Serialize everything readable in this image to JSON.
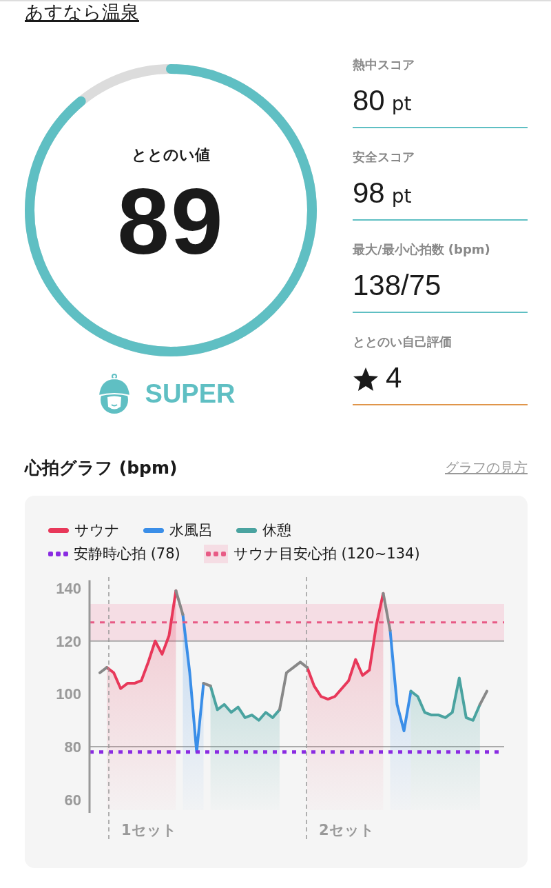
{
  "title": "あすなら温泉",
  "gauge": {
    "label": "ととのい値",
    "value": "89",
    "level": 0.89
  },
  "rank": {
    "label": "SUPER"
  },
  "stats": [
    {
      "kind": "score",
      "label": "熱中スコア",
      "value": "80",
      "unit": "pt",
      "color": "#5fbfc3"
    },
    {
      "kind": "score",
      "label": "安全スコア",
      "value": "98",
      "unit": "pt",
      "color": "#5fbfc3"
    },
    {
      "kind": "plain",
      "label": "最大/最小心拍数 (bpm)",
      "value": "138/75",
      "color": "#5fbfc3"
    },
    {
      "kind": "rating",
      "label": "ととのい自己評価",
      "value": "4",
      "color": "#e0954a"
    }
  ],
  "heart_graph": {
    "title": "心拍グラフ (bpm)",
    "help_link": "グラフの見方",
    "chart_data": {
      "type": "line",
      "grid": true,
      "ylim": [
        55,
        143
      ],
      "yticks": [
        60,
        80,
        100,
        120,
        140
      ],
      "categories": [
        null,
        null,
        null,
        null,
        null,
        null,
        null,
        null,
        null,
        null,
        null,
        null,
        null,
        null,
        null,
        null,
        null,
        null,
        null,
        null,
        null,
        null,
        null,
        null,
        null,
        null,
        null,
        null,
        null,
        null,
        null,
        null,
        null,
        null,
        null,
        null,
        null,
        null,
        null,
        null,
        null,
        null,
        null,
        null,
        null,
        null,
        null,
        null,
        null,
        null,
        null,
        null,
        null,
        null,
        null,
        null,
        null,
        null,
        null,
        null
      ],
      "series": [
        {
          "name": "サウナ",
          "color": "#e8385a",
          "values": [
            null,
            null,
            110,
            108,
            102,
            104,
            104,
            105,
            112,
            120,
            115,
            122,
            139,
            null,
            null,
            null,
            null,
            null,
            null,
            null,
            null,
            null,
            null,
            null,
            null,
            null,
            null,
            null,
            null,
            null,
            null,
            110,
            103,
            99,
            98,
            99,
            102,
            105,
            113,
            107,
            109,
            126,
            138,
            null,
            null,
            null,
            null,
            null,
            null,
            null,
            null,
            null,
            null,
            null,
            null,
            null,
            null,
            null,
            null,
            null
          ]
        },
        {
          "name": "水風呂",
          "color": "#3a8ee8",
          "values": [
            null,
            null,
            null,
            null,
            null,
            null,
            null,
            null,
            null,
            null,
            null,
            null,
            null,
            130,
            108,
            78,
            104,
            null,
            null,
            null,
            null,
            null,
            null,
            null,
            null,
            null,
            null,
            null,
            null,
            null,
            null,
            null,
            null,
            null,
            null,
            null,
            null,
            null,
            null,
            null,
            null,
            null,
            null,
            124,
            96,
            86,
            101,
            null,
            null,
            null,
            null,
            null,
            null,
            null,
            null,
            null,
            null,
            null,
            null,
            null
          ]
        },
        {
          "name": "休憩",
          "color": "#4aa3a0",
          "values": [
            null,
            null,
            null,
            null,
            null,
            null,
            null,
            null,
            null,
            null,
            null,
            null,
            null,
            null,
            null,
            null,
            null,
            103,
            94,
            96,
            93,
            95,
            91,
            92,
            90,
            93,
            91,
            94,
            null,
            null,
            null,
            null,
            null,
            null,
            null,
            null,
            null,
            null,
            null,
            null,
            null,
            null,
            null,
            null,
            null,
            null,
            101,
            99,
            93,
            92,
            92,
            91,
            93,
            106,
            91,
            90,
            96,
            null,
            null,
            null
          ]
        },
        {
          "color": "#888888",
          "values": [
            null,
            108,
            110,
            null,
            null,
            null,
            null,
            null,
            null,
            null,
            null,
            null,
            139,
            130,
            null,
            null,
            104,
            103,
            null,
            null,
            null,
            null,
            null,
            null,
            null,
            null,
            null,
            94,
            108,
            110,
            112,
            110,
            null,
            null,
            null,
            null,
            null,
            null,
            null,
            null,
            null,
            null,
            138,
            124,
            null,
            null,
            null,
            null,
            null,
            null,
            null,
            null,
            null,
            null,
            null,
            null,
            96,
            101,
            null,
            null
          ]
        }
      ],
      "ref_lines": [
        {
          "axis": "y",
          "value": 78,
          "color": "#8a2be2",
          "label": "安静時心拍 (78)"
        },
        {
          "axis": "y",
          "value": 127,
          "color": "#e85a85",
          "label": "サウナ目安心拍 (120~134)"
        }
      ],
      "bands": [
        {
          "axis": "y",
          "from": 120,
          "to": 134,
          "color": "#f5dde4"
        }
      ]
    },
    "set_labels": [
      "1セット",
      "2セット"
    ]
  }
}
